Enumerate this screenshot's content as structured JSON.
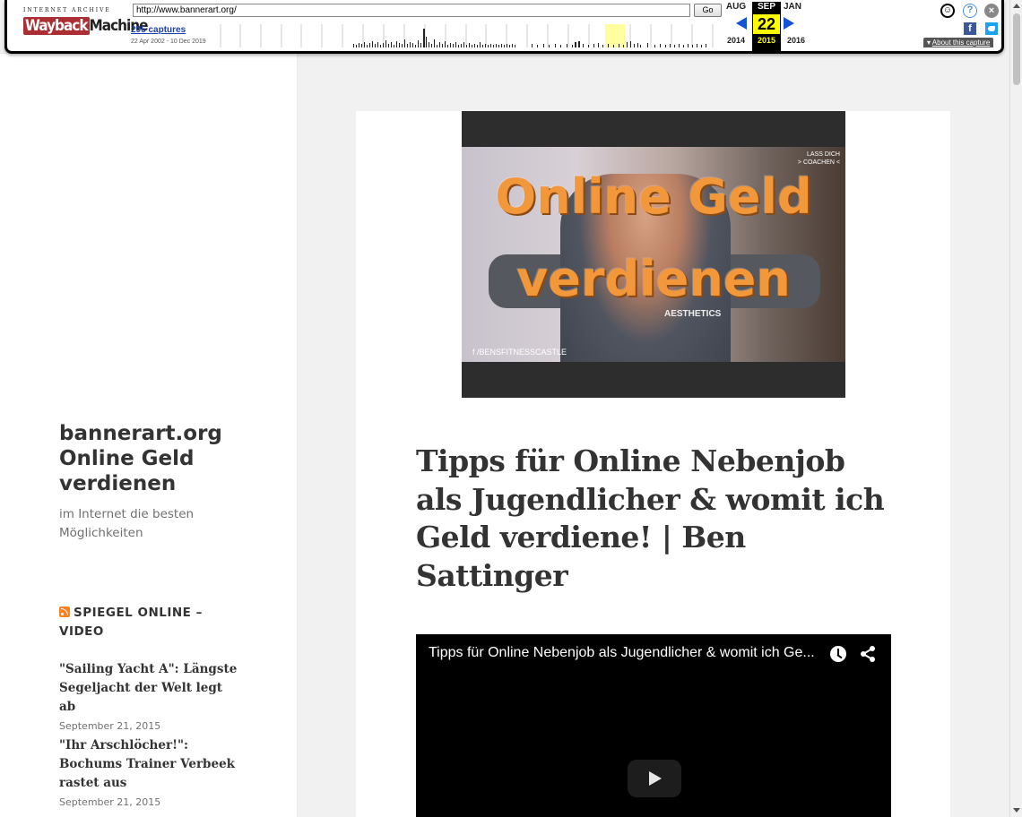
{
  "wayback": {
    "ia_label": "INTERNET ARCHIVE",
    "logo_part1": "Wayback",
    "logo_part2": "Machine",
    "url": "http://www.bannerart.org/",
    "go_label": "Go",
    "captures": "295 captures",
    "range": "22 Apr 2002 - 10 Dec 2019",
    "months": [
      "AUG",
      "SEP",
      "JAN"
    ],
    "day": "22",
    "years": [
      "2014",
      "2015",
      "2016"
    ],
    "about": "About this capture",
    "facebook_glyph": "f",
    "user_glyph": "☺",
    "help_glyph": "?",
    "close_glyph": "×"
  },
  "site": {
    "title": "bannerart.org Online Geld verdienen",
    "description": "im Internet die besten Möglichkeiten"
  },
  "widget": {
    "title": "SPIEGEL ONLINE – VIDEO",
    "items": [
      {
        "title": "\"Sailing Yacht A\": Längste Segeljacht der Welt legt ab",
        "date": "September 21, 2015"
      },
      {
        "title": "\"Ihr Arschlöcher!\": Bochums Trainer Verbeek rastet aus",
        "date": "September 21, 2015"
      }
    ]
  },
  "post": {
    "thumbnail": {
      "line1": "Online Geld",
      "line2": "verdienen",
      "badge_line1": "LASS DICH",
      "badge_line2": "> COACHEN <",
      "social": "f /BENSFITNESSCASTLE",
      "shirt": "AESTHETICS"
    },
    "title": "Tipps für Online Nebenjob als Jugendlicher & womit ich Geld verdiene! | Ben Sattinger",
    "video_title": "Tipps für Online Nebenjob als Jugendlicher & womit ich Ge..."
  },
  "colors": {
    "wayback_red": "#ab2e33",
    "nav_arrow": "#1553d6",
    "highlight_day": "#ffff00",
    "thumb_text": "#f2973a"
  }
}
